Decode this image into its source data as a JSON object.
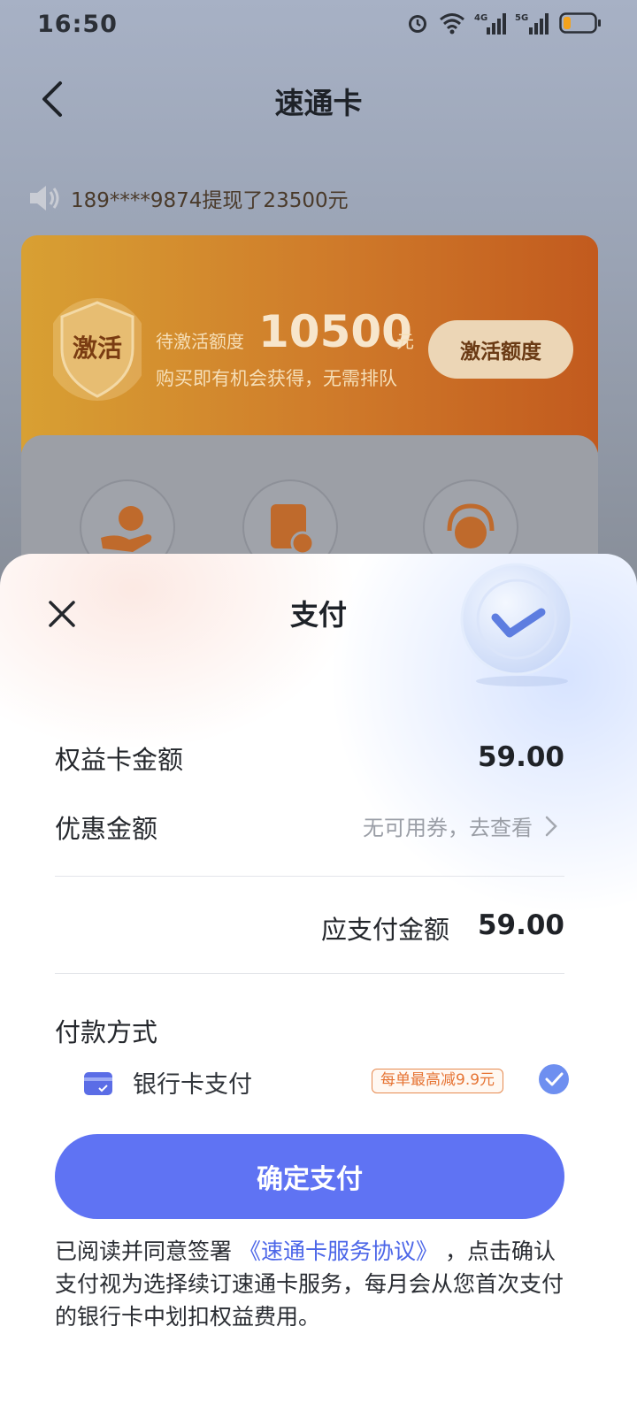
{
  "status_bar": {
    "time": "16:50"
  },
  "nav": {
    "title": "速通卡"
  },
  "notice": {
    "text": "189****9874提现了23500元"
  },
  "activation_card": {
    "shield_label": "激活",
    "pending_label": "待激活额度",
    "amount": "10500",
    "unit": "元",
    "subtitle": "购买即有机会获得，无需排队",
    "button_label": "激活额度"
  },
  "sheet": {
    "title": "支付",
    "benefit_label": "权益卡金额",
    "benefit_value": "59.00",
    "discount_label": "优惠金额",
    "discount_value": "无可用券，去查看",
    "payable_label": "应支付金额",
    "payable_value": "59.00",
    "pay_method_title": "付款方式",
    "bank_label": "银行卡支付",
    "bank_tag": "每单最高减9.9元",
    "confirm_label": "确定支付",
    "agreement_prefix": "已阅读并同意签署",
    "agreement_link": "《速通卡服务协议》",
    "agreement_suffix": "，点击确认支付视为选择续订速通卡服务，每月会从您首次支付的银行卡中划扣权益费用。"
  },
  "colors": {
    "primary_button": "#5f73f3",
    "link": "#4c66e8",
    "tag": "#e67434",
    "check": "#6e8ff0"
  }
}
